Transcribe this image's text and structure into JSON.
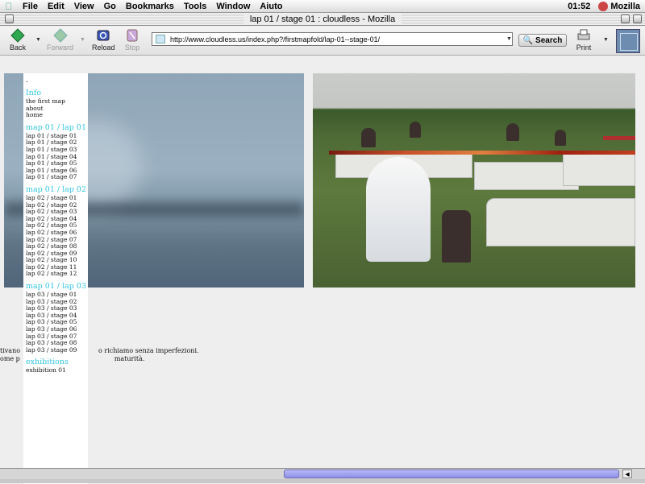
{
  "menubar": {
    "items": [
      "File",
      "Edit",
      "View",
      "Go",
      "Bookmarks",
      "Tools",
      "Window",
      "Aiuto"
    ],
    "clock": "01:52",
    "app_name": "Mozilla"
  },
  "window": {
    "title": "lap 01 / stage 01 : cloudless - Mozilla"
  },
  "toolbar": {
    "back": "Back",
    "forward": "Forward",
    "reload": "Reload",
    "stop": "Stop",
    "url": "http://www.cloudless.us/index.php?/firstmapfold/lap-01--stage-01/",
    "search": "Search",
    "print": "Print"
  },
  "sidebar": {
    "dot": ".",
    "sections": [
      {
        "heading": "Info",
        "links": [
          "the first map",
          "about",
          "home"
        ]
      },
      {
        "heading": "map 01 / lap 01",
        "links": [
          "lap 01 / stage 01",
          "lap 01 / stage 02",
          "lap 01 / stage 03",
          "lap 01 / stage 04",
          "lap 01 / stage 05",
          "lap 01 / stage 06",
          "lap 01 / stage 07"
        ]
      },
      {
        "heading": "map 01 / lap 02",
        "links": [
          "lap 02 / stage 01",
          "lap 02 / stage 02",
          "lap 02 / stage 03",
          "lap 02 / stage 04",
          "lap 02 / stage 05",
          "lap 02 / stage 06",
          "lap 02 / stage 07",
          "lap 02 / stage 08",
          "lap 02 / stage 09",
          "lap 02 / stage 10",
          "lap 02 / stage 11",
          "lap 02 / stage 12"
        ]
      },
      {
        "heading": "map 01 / lap 03",
        "links": [
          "lap 03 / stage 01",
          "lap 03 / stage 02",
          "lap 03 / stage 03",
          "lap 03 / stage 04",
          "lap 03 / stage 05",
          "lap 03 / stage 06",
          "lap 03 / stage 07",
          "lap 03 / stage 08",
          "lap 03 / stage 09"
        ]
      },
      {
        "heading": "exhibitions",
        "links": [
          "exhibition 01"
        ]
      }
    ]
  },
  "body_text": {
    "line1_left": "tivano",
    "line1_right": "o richiamo senza imperfezioni.",
    "line2_left": "ome p",
    "line2_right": "maturità."
  }
}
